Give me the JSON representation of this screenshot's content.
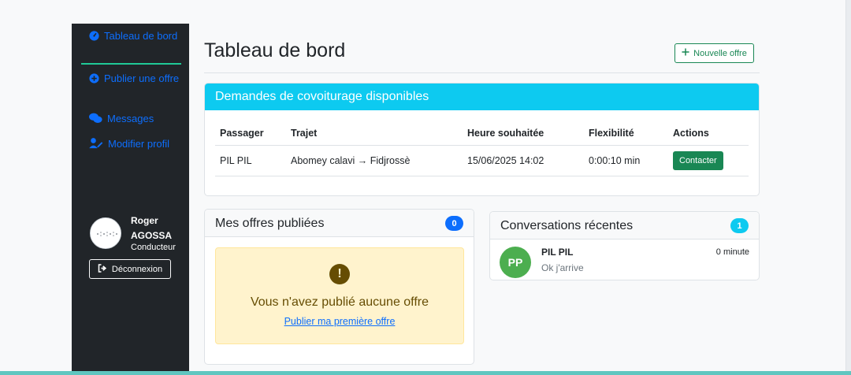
{
  "sidebar": {
    "items": [
      {
        "label": "Tableau de bord",
        "icon": "dashboard-icon"
      },
      {
        "label": "Publier une offre",
        "icon": "plus-circle-icon"
      },
      {
        "label": "Messages",
        "icon": "chat-icon"
      },
      {
        "label": "Modifier profil",
        "icon": "user-edit-icon"
      }
    ],
    "user": {
      "name": "Roger AGOSSA",
      "role": "Conducteur",
      "avatar_icon": "avatar-icon"
    },
    "logout_label": "Déconnexion"
  },
  "header": {
    "title": "Tableau de bord",
    "new_offer_label": "Nouvelle offre"
  },
  "requests": {
    "title": "Demandes de covoiturage disponibles",
    "columns": [
      "Passager",
      "Trajet",
      "Heure souhaitée",
      "Flexibilité",
      "Actions"
    ],
    "rows": [
      {
        "passenger": "PIL PIL",
        "route": "Abomey calavi → Fidjrossè",
        "time": "15/06/2025 14:02",
        "flex": "0:00:10 min",
        "action": "Contacter"
      }
    ]
  },
  "offers": {
    "title": "Mes offres publiées",
    "count": "0",
    "empty_icon": "!",
    "empty_text": "Vous n'avez publié aucune offre",
    "empty_link": "Publier ma première offre"
  },
  "conversations": {
    "title": "Conversations récentes",
    "count": "1",
    "items": [
      {
        "initials": "PP",
        "name": "PIL PIL",
        "message": "Ok j'arrive",
        "time": "0 minute"
      }
    ]
  },
  "colors": {
    "accent": "#0dcaf0",
    "success": "#198754",
    "sidebar_bg": "#212529",
    "link": "#0d6efd",
    "warning_bg": "#fff3cd"
  }
}
